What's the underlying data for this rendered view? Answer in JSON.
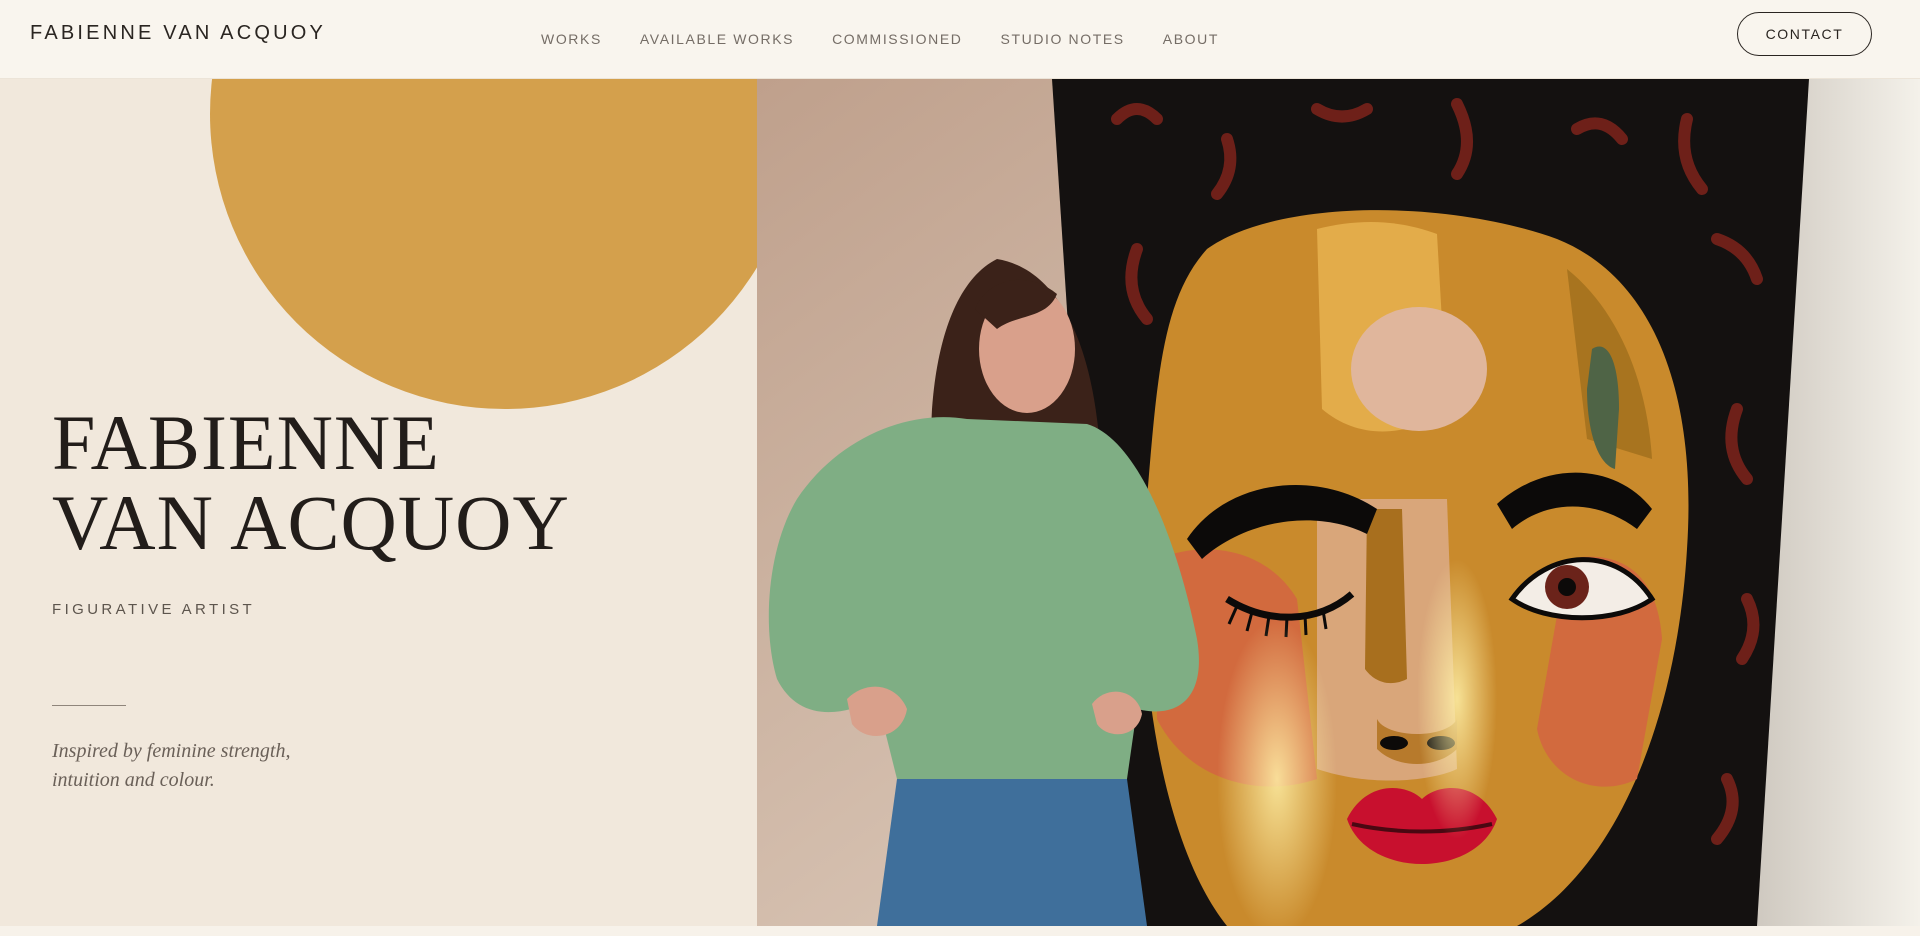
{
  "header": {
    "brand": "FABIENNE VAN ACQUOY",
    "nav": [
      "WORKS",
      "AVAILABLE WORKS",
      "COMMISSIONED",
      "STUDIO NOTES",
      "ABOUT"
    ],
    "contact_label": "CONTACT"
  },
  "hero": {
    "title_line1": "FABIENNE",
    "title_line2": "VAN ACQUOY",
    "subtitle": "FIGURATIVE ARTIST",
    "tagline_line1": "Inspired by feminine strength,",
    "tagline_line2": "intuition and colour.",
    "photo_icon": "artist-portrait-photo"
  },
  "colors": {
    "background": "#f9f5ee",
    "hero_panel": "#f1e8dc",
    "accent_sun": "#d4a04c",
    "text_dark": "#2a2521",
    "nav_text": "#756d66"
  }
}
